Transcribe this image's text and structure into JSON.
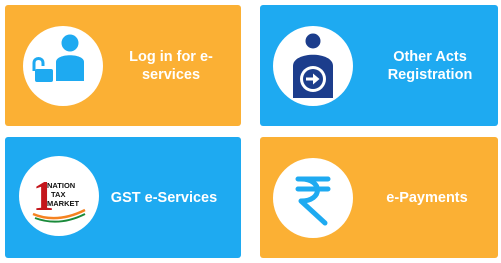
{
  "tiles": [
    {
      "label": "Log in for e-\nservices",
      "icon": "user-lock-icon"
    },
    {
      "label": "Other Acts\nRegistration",
      "icon": "person-arrow-icon"
    },
    {
      "label": "GST e-Services",
      "icon": "nation-tax-market-logo"
    },
    {
      "label": "e-Payments",
      "icon": "rupee-icon"
    }
  ],
  "logo": {
    "numeral": "1",
    "line1": "NATION",
    "line2": "TAX",
    "line3": "MARKET"
  },
  "colors": {
    "orange": "#fbb034",
    "blue": "#1eaaf1",
    "icon_blue": "#1eaaf1",
    "text": "#ffffff"
  }
}
